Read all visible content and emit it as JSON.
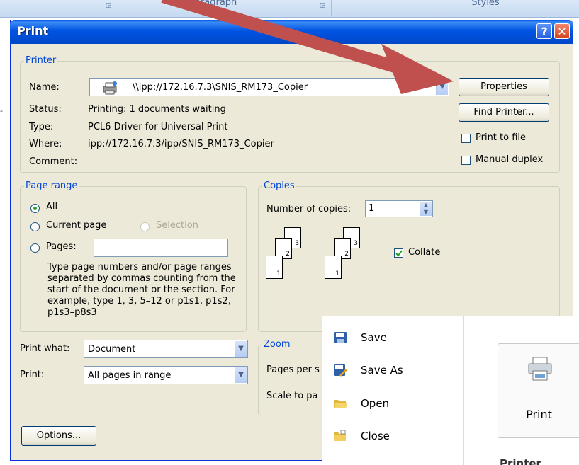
{
  "ribbon": {
    "group1": "Paragraph",
    "group2": "Styles"
  },
  "dialog": {
    "title": "Print",
    "help_glyph": "?",
    "close_glyph": "✕",
    "printer": {
      "legend": "Printer",
      "name_label": "Name:",
      "name_value": "\\\\ipp://172.16.7.3\\SNIS_RM173_Copier",
      "status_label": "Status:",
      "status_value": "Printing: 1 documents waiting",
      "type_label": "Type:",
      "type_value": "PCL6 Driver for Universal Print",
      "where_label": "Where:",
      "where_value": "ipp://172.16.7.3/ipp/SNIS_RM173_Copier",
      "comment_label": "Comment:",
      "comment_value": "",
      "properties_button": "Properties",
      "find_printer_button": "Find Printer...",
      "print_to_file_label": "Print to file",
      "print_to_file_checked": false,
      "manual_duplex_label": "Manual duplex",
      "manual_duplex_checked": false
    },
    "page_range": {
      "legend": "Page range",
      "all_label": "All",
      "current_page_label": "Current page",
      "selection_label": "Selection",
      "pages_label": "Pages:",
      "pages_value": "",
      "selected": "All",
      "help_text": "Type page numbers and/or page ranges separated by commas counting from the start of the document or the section. For example, type 1, 3, 5–12 or p1s1, p1s2, p1s3–p8s3"
    },
    "copies": {
      "legend": "Copies",
      "number_label": "Number of copies:",
      "number_value": "1",
      "collate_label": "Collate",
      "collate_checked": true,
      "page_numbers": [
        "1",
        "2",
        "3"
      ]
    },
    "print_what_label": "Print what:",
    "print_what_value": "Document",
    "print_label": "Print:",
    "print_value": "All pages in range",
    "zoom": {
      "legend": "Zoom",
      "pages_per_sheet_label": "Pages per s",
      "scale_label": "Scale to pa"
    },
    "options_button": "Options..."
  },
  "backstage": {
    "items": [
      {
        "label": "Save",
        "icon": "save-icon"
      },
      {
        "label": "Save As",
        "icon": "save-as-icon"
      },
      {
        "label": "Open",
        "icon": "open-folder-icon"
      },
      {
        "label": "Close",
        "icon": "close-folder-icon"
      }
    ],
    "print_button": "Print",
    "printer_heading": "Printer"
  },
  "colors": {
    "annotation_arrow": "#c0504d",
    "title_bar": "#0054e3",
    "legend_text": "#0046d5"
  }
}
